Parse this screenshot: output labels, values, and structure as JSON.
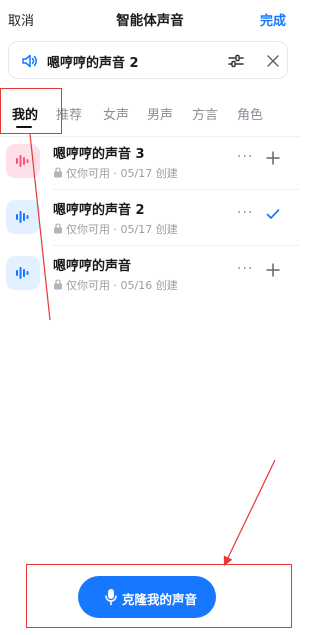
{
  "header": {
    "cancel_label": "取消",
    "title": "智能体声音",
    "done_label": "完成"
  },
  "current_voice": {
    "name": "嗯哼哼的声音 2",
    "speaker_icon": "speaker-icon",
    "adjust_icon": "sliders-icon",
    "close_icon": "close-icon"
  },
  "tabs": [
    {
      "label": "我的",
      "active": true
    },
    {
      "label": "推荐",
      "active": false
    },
    {
      "label": "女声",
      "active": false
    },
    {
      "label": "男声",
      "active": false
    },
    {
      "label": "方言",
      "active": false
    },
    {
      "label": "角色",
      "active": false
    }
  ],
  "voices": [
    {
      "title": "嗯哼哼的声音 3",
      "availability": "仅你可用",
      "separator": "·",
      "created": "05/17 创建",
      "thumb_color": "#ffe0e8",
      "wave_color": "#ff4d79",
      "more": "···",
      "action_icon": "plus-icon",
      "selected": false
    },
    {
      "title": "嗯哼哼的声音 2",
      "availability": "仅你可用",
      "separator": "·",
      "created": "05/17 创建",
      "thumb_color": "#e3f0ff",
      "wave_color": "#1677ff",
      "more": "···",
      "action_icon": "check-icon",
      "selected": true
    },
    {
      "title": "嗯哼哼的声音",
      "availability": "仅你可用",
      "separator": "·",
      "created": "05/16 创建",
      "thumb_color": "#e3f0ff",
      "wave_color": "#1677ff",
      "more": "···",
      "action_icon": "plus-icon",
      "selected": false
    }
  ],
  "clone_button": {
    "label": "克隆我的声音",
    "icon": "microphone-icon"
  },
  "colors": {
    "accent": "#1677ff",
    "annotation": "#e53935"
  }
}
